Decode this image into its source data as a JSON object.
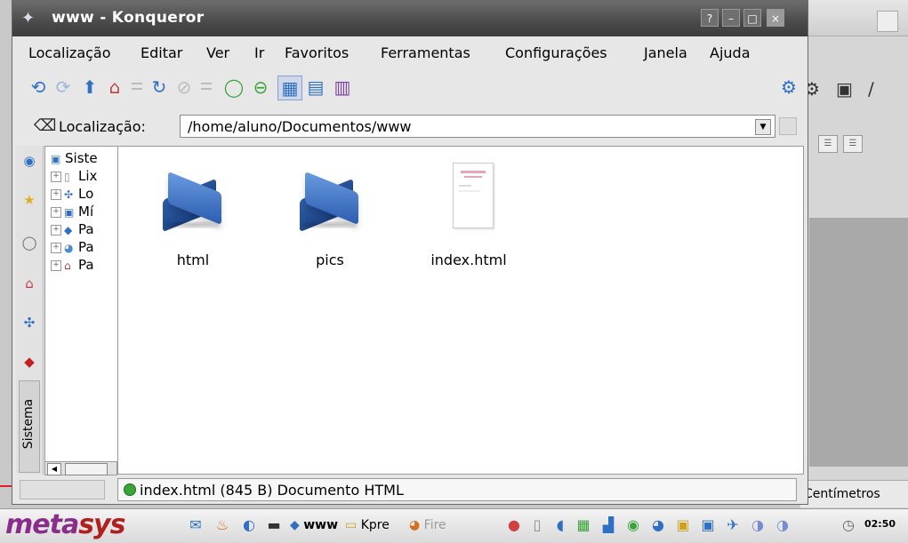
{
  "window": {
    "title": "www - Konqueror",
    "buttons": {
      "help": "?",
      "minimize": "–",
      "maximize": "□",
      "close": "×"
    }
  },
  "menu": [
    "Localização",
    "Editar",
    "Ver",
    "Ir",
    "Favoritos",
    "Ferramentas",
    "Configurações",
    "Janela",
    "Ajuda"
  ],
  "location": {
    "label": "Localização:",
    "url": "/home/aluno/Documentos/www"
  },
  "sidebar": {
    "tab_label": "Sistema",
    "tree": [
      {
        "label": "Siste",
        "icon": "computer-icon"
      },
      {
        "label": "Lix",
        "icon": "trash-icon"
      },
      {
        "label": "Lo",
        "icon": "network-icon"
      },
      {
        "label": "Mí",
        "icon": "media-icon"
      },
      {
        "label": "Pa",
        "icon": "folder-icon"
      },
      {
        "label": "Pa",
        "icon": "globe-icon"
      },
      {
        "label": "Pa",
        "icon": "home-icon"
      }
    ]
  },
  "files": [
    {
      "name": "html",
      "type": "folder"
    },
    {
      "name": "pics",
      "type": "folder"
    },
    {
      "name": "index.html",
      "type": "document"
    }
  ],
  "status": {
    "text": "index.html (845 B)  Documento HTML"
  },
  "background_app": {
    "status_text": "Centímetros"
  },
  "taskbar": {
    "logo_a": "meta",
    "logo_b": "sys",
    "tasks": [
      "www",
      "Kpre",
      "Fire"
    ],
    "clock": "02:50"
  },
  "colors": {
    "titlebar": "#4a4a4a",
    "folder": "#2b5cb0",
    "status_ok": "#3aa33a"
  }
}
